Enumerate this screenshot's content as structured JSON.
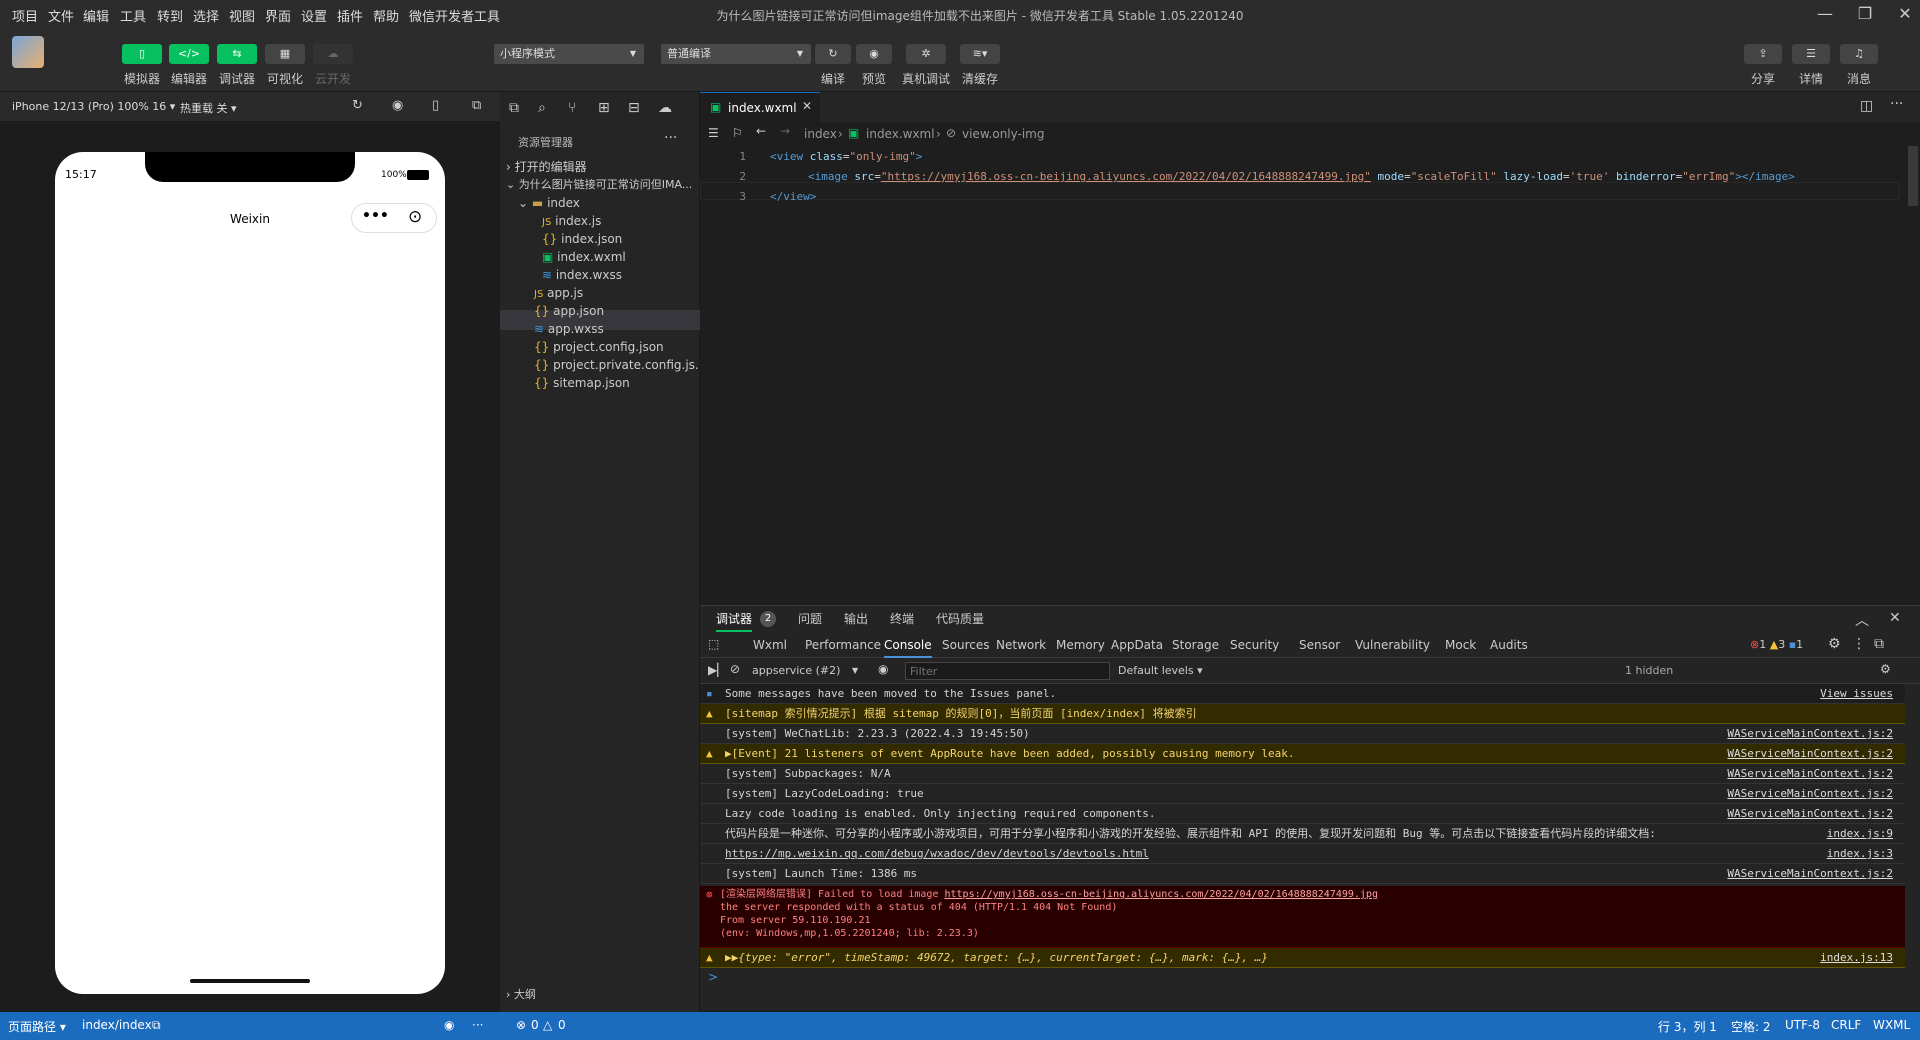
{
  "menu": [
    "项目",
    "文件",
    "编辑",
    "工具",
    "转到",
    "选择",
    "视图",
    "界面",
    "设置",
    "插件",
    "帮助",
    "微信开发者工具"
  ],
  "window_title": "为什么图片链接可正常访问但image组件加载不出来图片 - 微信开发者工具 Stable 1.05.2201240",
  "toolbar": {
    "simulator": "模拟器",
    "editor": "编辑器",
    "debugger": "调试器",
    "visual": "可视化",
    "cloud": "云开发",
    "mode": "小程序模式",
    "compile_mode": "普通编译",
    "compile": "编译",
    "preview": "预览",
    "real_debug": "真机调试",
    "clear_cache": "清缓存",
    "share": "分享",
    "detail": "详情",
    "message": "消息"
  },
  "sim": {
    "device": "iPhone 12/13 (Pro) 100% 16 ▾",
    "hot_reload": "热重载 关 ▾",
    "time": "15:17",
    "battery": "100%",
    "nav_title": "Weixin"
  },
  "explorer": {
    "header": "资源管理器",
    "open_editors": "打开的编辑器",
    "project": "为什么图片链接可正常访问但IMA...",
    "folder": "index",
    "files": [
      "index.js",
      "index.json",
      "index.wxml",
      "index.wxss"
    ],
    "root_files": [
      "app.js",
      "app.json",
      "app.wxss",
      "project.config.json",
      "project.private.config.js...",
      "sitemap.json"
    ],
    "outline": "大纲"
  },
  "editor": {
    "tab": "index.wxml",
    "crumb": [
      "index",
      "index.wxml",
      "view.only-img"
    ],
    "lines": [
      {
        "n": "1",
        "parts": [
          [
            "<view ",
            "tag"
          ],
          [
            "class",
            "attr"
          ],
          [
            "=",
            "pun"
          ],
          [
            "\"only-img\"",
            "str"
          ],
          [
            ">",
            "tag"
          ]
        ]
      },
      {
        "n": "2",
        "parts": [
          [
            "<image ",
            "tag"
          ],
          [
            "src",
            "attr"
          ],
          [
            "=",
            "pun"
          ],
          [
            "\"https://ymyj168.oss-cn-beijing.aliyuncs.com/2022/04/02/1648888247499.jpg\"",
            "url"
          ],
          [
            " mode",
            "attr"
          ],
          [
            "=",
            "pun"
          ],
          [
            "\"scaleToFill\"",
            "str"
          ],
          [
            " lazy-load",
            "attr"
          ],
          [
            "=",
            "pun"
          ],
          [
            "'true'",
            "str"
          ],
          [
            " binderror",
            "attr"
          ],
          [
            "=",
            "pun"
          ],
          [
            "\"errImg\"",
            "str"
          ],
          [
            "></image>",
            "tag"
          ]
        ]
      },
      {
        "n": "3",
        "parts": [
          [
            "</view>",
            "tag"
          ]
        ]
      }
    ]
  },
  "devtools": {
    "top_tabs": [
      "调试器",
      "问题",
      "输出",
      "终端",
      "代码质量"
    ],
    "badge": "2",
    "tabs": [
      "Wxml",
      "Performance",
      "Console",
      "Sources",
      "Network",
      "Memory",
      "AppData",
      "Storage",
      "Security",
      "Sensor",
      "Vulnerability",
      "Mock",
      "Audits"
    ],
    "counts": {
      "err": "1",
      "warn": "3",
      "info": "1"
    },
    "context": "appservice (#2)",
    "filter_placeholder": "Filter",
    "levels": "Default levels ▾",
    "hidden": "1 hidden",
    "rows": [
      {
        "type": "info",
        "msg": "Some messages have been moved to the Issues panel.",
        "src": "View issues"
      },
      {
        "type": "warn",
        "msg": "[sitemap 索引情况提示] 根据 sitemap 的规则[0]，当前页面 [index/index] 将被索引",
        "src": ""
      },
      {
        "type": "log",
        "msg": "[system] WeChatLib: 2.23.3 (2022.4.3 19:45:50)",
        "src": "WAServiceMainContext.js:2"
      },
      {
        "type": "warn",
        "msg": "▶[Event] 21 listeners of event AppRoute have been added, possibly causing memory leak.",
        "src": "WAServiceMainContext.js:2"
      },
      {
        "type": "log",
        "msg": "[system] Subpackages: N/A",
        "src": "WAServiceMainContext.js:2"
      },
      {
        "type": "log",
        "msg": "[system] LazyCodeLoading: true",
        "src": "WAServiceMainContext.js:2"
      },
      {
        "type": "log",
        "msg": "Lazy code loading is enabled. Only injecting required components.",
        "src": "WAServiceMainContext.js:2"
      },
      {
        "type": "log",
        "msg": "代码片段是一种迷你、可分享的小程序或小游戏项目，可用于分享小程序和小游戏的开发经验、展示组件和 API 的使用、复现开发问题和 Bug 等。可点击以下链接查看代码片段的详细文档:",
        "src": "index.js:9"
      },
      {
        "type": "log",
        "msg": "https://mp.weixin.qq.com/debug/wxadoc/dev/devtools/devtools.html",
        "src": "index.js:3"
      },
      {
        "type": "log",
        "msg": "[system] Launch Time: 1386 ms",
        "src": "WAServiceMainContext.js:2"
      }
    ],
    "error": {
      "l1a": "[渲染层网络层错误] Failed to load image ",
      "l1b": "https://ymyj168.oss-cn-beijing.aliyuncs.com/2022/04/02/1648888247499.jpg",
      "l2": "the server responded with a status of 404 (HTTP/1.1 404 Not Found)",
      "l3": "From server 59.110.190.21",
      "l4": "(env: Windows,mp,1.05.2201240; lib: 2.23.3)"
    },
    "last_row": {
      "msg": "▶▶{type: \"error\", timeStamp: 49672, target: {…}, currentTarget: {…}, mark: {…}, …}",
      "src": "index.js:13"
    },
    "prompt": ">"
  },
  "status": {
    "page_path": "页面路径 ▾",
    "path": "index/index",
    "errs": "0",
    "warns": "0",
    "cursor": "行 3，列 1",
    "spaces": "空格: 2",
    "enc": "UTF-8",
    "eol": "CRLF",
    "lang": "WXML"
  },
  "colors": {
    "accent": "#07c160",
    "status": "#1b6bbf",
    "error": "#fe8080",
    "warn": "#f3d36d"
  }
}
